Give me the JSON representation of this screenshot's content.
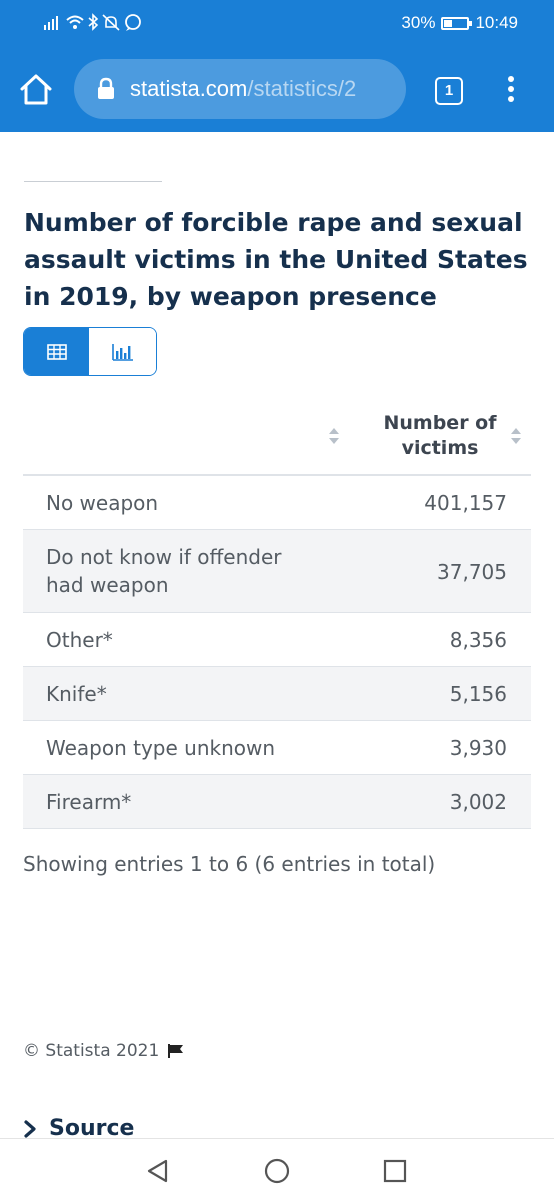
{
  "status_bar": {
    "battery": "30%",
    "time": "10:49"
  },
  "browser": {
    "url_domain": "statista.com",
    "url_path": "/statistics/2",
    "tab_count": "1"
  },
  "page": {
    "title": "Number of forcible rape and sexual assault victims in the United States in 2019, by weapon presence",
    "accent_color": "#1a7fd6",
    "title_color": "#16304d"
  },
  "table": {
    "column_header": "Number of victims",
    "rows": [
      {
        "label": "No weapon",
        "value": "401,157"
      },
      {
        "label": "Do not know if offender had weapon",
        "value": "37,705"
      },
      {
        "label": "Other*",
        "value": "8,356"
      },
      {
        "label": "Knife*",
        "value": "5,156"
      },
      {
        "label": "Weapon type unknown",
        "value": "3,930"
      },
      {
        "label": "Firearm*",
        "value": "3,002"
      }
    ],
    "entries_info": "Showing entries 1 to 6 (6 entries in total)"
  },
  "footer": {
    "copyright": "© Statista 2021",
    "source_label": "Source"
  },
  "icons": {
    "home": "home-icon",
    "lock": "lock-icon",
    "menu": "more-vertical-icon",
    "table_view": "table-icon",
    "chart_view": "bar-chart-icon",
    "flag": "flag-icon",
    "source": "chevron-right-icon",
    "nav_back": "triangle-back-icon",
    "nav_home": "circle-home-icon",
    "nav_recents": "square-recents-icon"
  }
}
